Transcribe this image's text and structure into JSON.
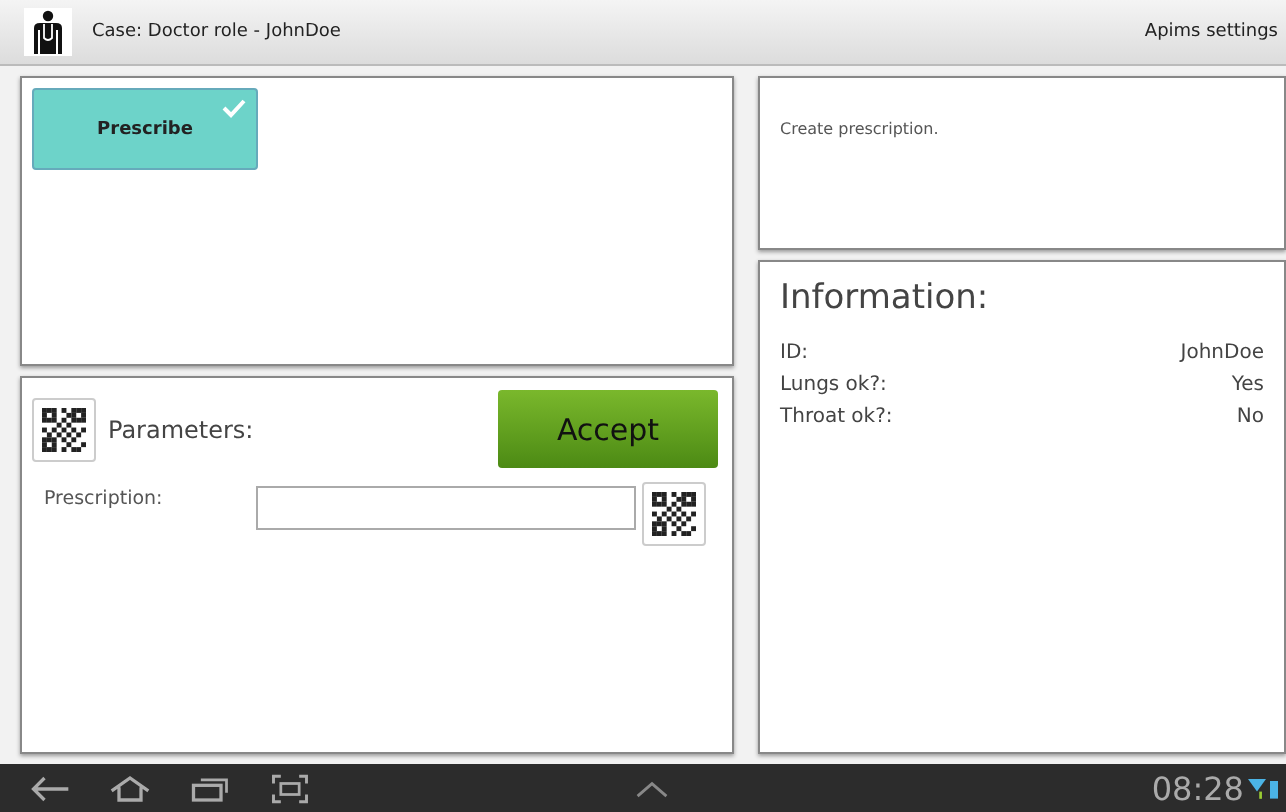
{
  "action_bar": {
    "title": "Case: Doctor role - JohnDoe",
    "menu": "Apims settings"
  },
  "actions": [
    {
      "label": "Prescribe",
      "checked": true
    }
  ],
  "parameters": {
    "title": "Parameters:",
    "accept": "Accept",
    "fields": [
      {
        "label": "Prescription:"
      }
    ]
  },
  "description": "Create prescription.",
  "information": {
    "title": "Information:",
    "rows": [
      {
        "label": "ID:",
        "value": "JohnDoe"
      },
      {
        "label": "Lungs ok?:",
        "value": "Yes"
      },
      {
        "label": "Throat ok?:",
        "value": "No"
      }
    ]
  },
  "nav_bar": {
    "time": "08:28"
  }
}
